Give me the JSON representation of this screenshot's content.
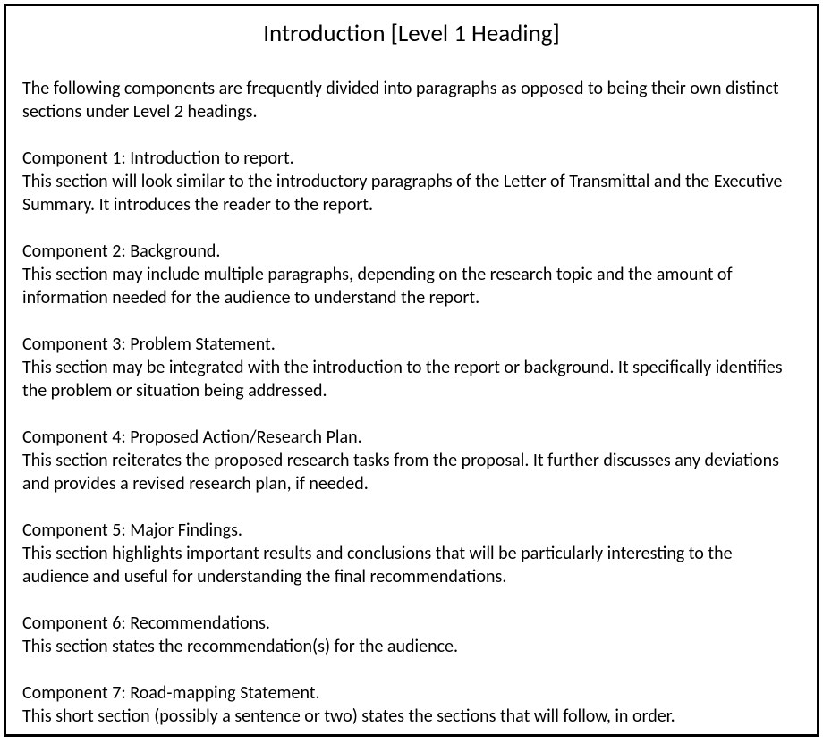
{
  "heading": "Introduction [Level 1 Heading]",
  "intro": "The following components are frequently divided into paragraphs as opposed to being their own distinct sections under Level 2 headings.",
  "components": [
    {
      "title": "Component 1: Introduction to report.",
      "desc": "This section will look similar to the introductory paragraphs of the Letter of Transmittal and the Executive Summary. It introduces the reader to the report."
    },
    {
      "title": "Component 2: Background.",
      "desc": "This section may include multiple paragraphs, depending on the research topic and the amount of information needed for the audience to understand the report."
    },
    {
      "title": "Component 3: Problem Statement.",
      "desc": "This section may be integrated with the introduction to the report or background. It specifically identifies the problem or situation being addressed."
    },
    {
      "title": "Component 4: Proposed Action/Research Plan.",
      "desc": "This section reiterates the proposed research tasks from the proposal. It further discusses any deviations and provides a revised research plan, if needed."
    },
    {
      "title": "Component 5: Major Findings.",
      "desc": "This section highlights important results and conclusions that will be particularly interesting to the audience and useful for understanding the final recommendations."
    },
    {
      "title": "Component 6: Recommendations.",
      "desc": "This section states the recommendation(s) for the audience."
    },
    {
      "title": "Component 7: Road-mapping Statement.",
      "desc": "This short section (possibly a sentence or two) states the sections that will follow, in order."
    }
  ]
}
